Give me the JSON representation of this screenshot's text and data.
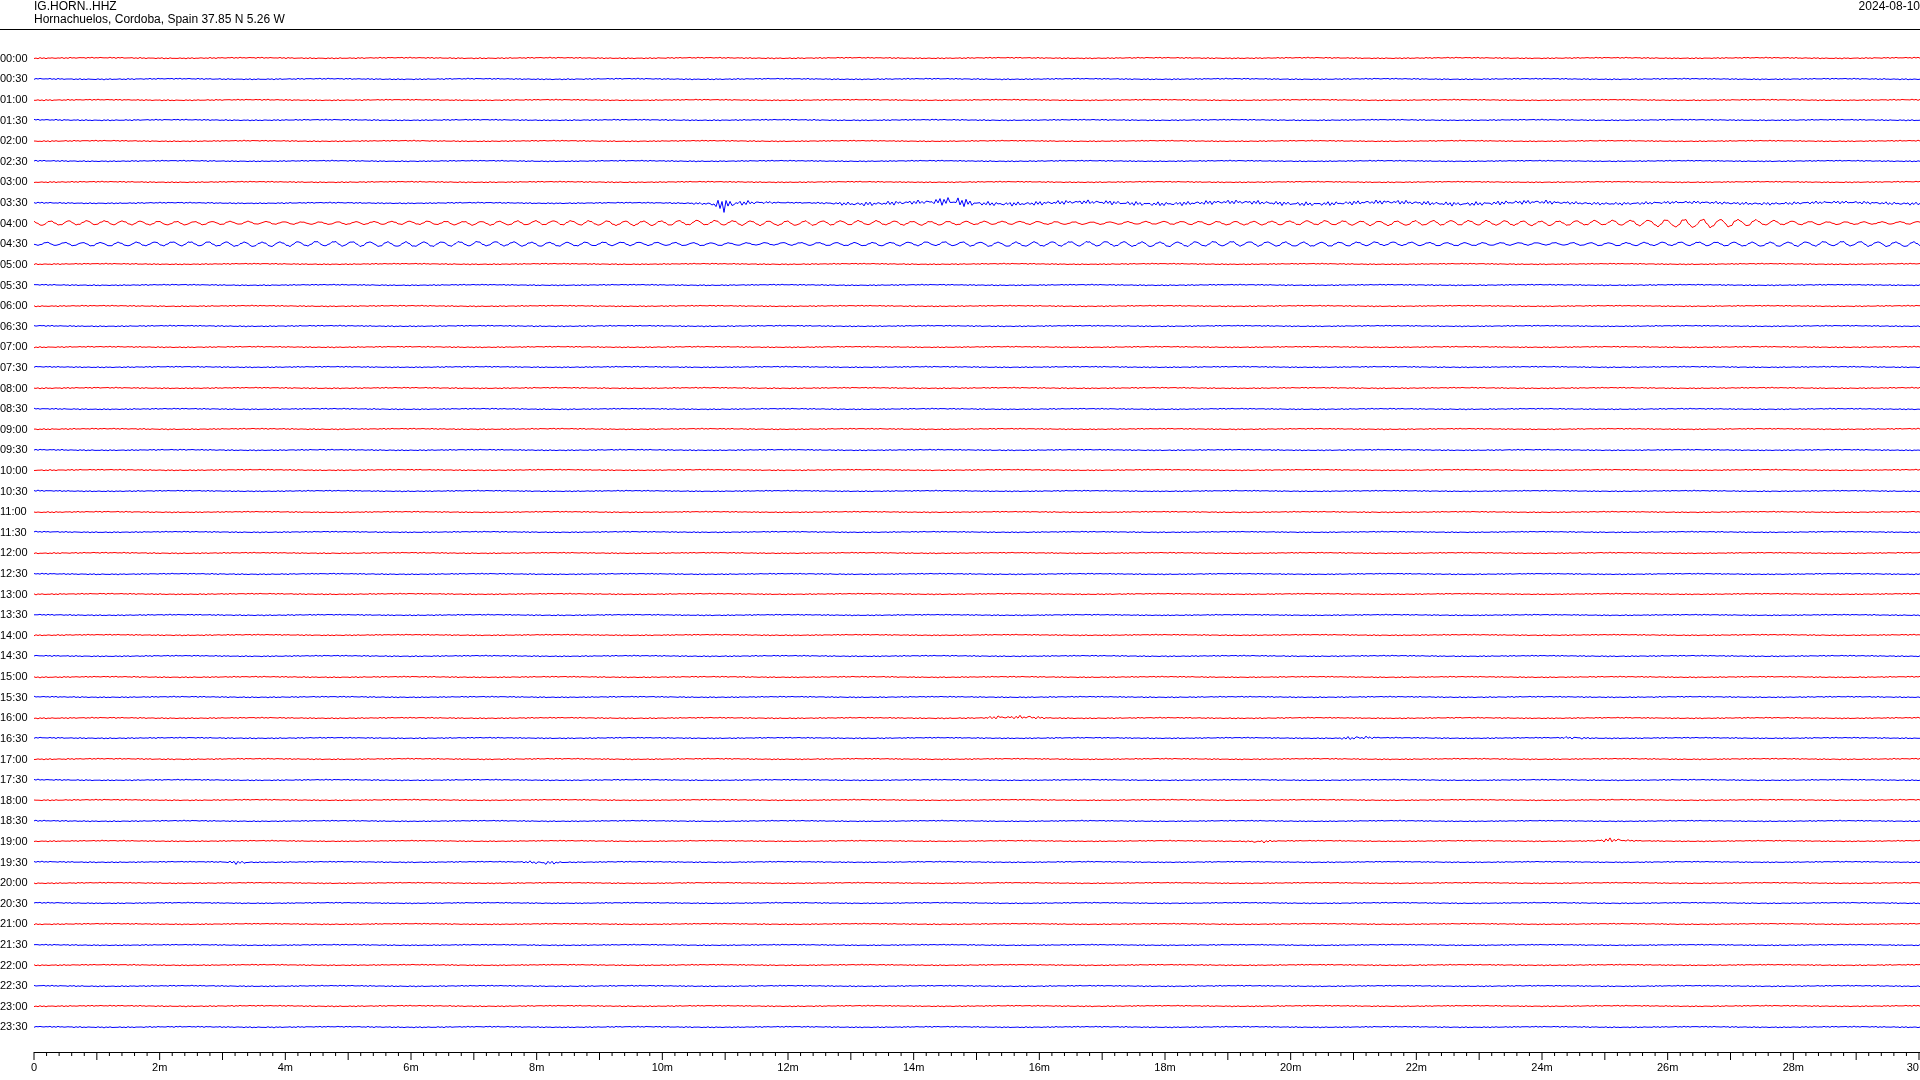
{
  "header": {
    "station": "IG.HORN..HHZ",
    "location": "Hornachuelos, Cordoba, Spain  37.85 N 5.26 W",
    "date": "2024-08-10"
  },
  "traces": [
    {
      "time": "00:00",
      "color": "#ff0000",
      "kind": "quiet"
    },
    {
      "time": "00:30",
      "color": "#0000ff",
      "kind": "quiet"
    },
    {
      "time": "01:00",
      "color": "#ff0000",
      "kind": "quiet"
    },
    {
      "time": "01:30",
      "color": "#0000ff",
      "kind": "quiet"
    },
    {
      "time": "02:00",
      "color": "#ff0000",
      "kind": "quiet"
    },
    {
      "time": "02:30",
      "color": "#0000ff",
      "kind": "quiet"
    },
    {
      "time": "03:00",
      "color": "#ff0000",
      "kind": "quiet"
    },
    {
      "time": "03:30",
      "color": "#0000ff",
      "kind": "event"
    },
    {
      "time": "04:00",
      "color": "#ff0000",
      "kind": "swell"
    },
    {
      "time": "04:30",
      "color": "#0000ff",
      "kind": "swell"
    },
    {
      "time": "05:00",
      "color": "#ff0000",
      "kind": "quiet"
    },
    {
      "time": "05:30",
      "color": "#0000ff",
      "kind": "quiet"
    },
    {
      "time": "06:00",
      "color": "#ff0000",
      "kind": "quiet"
    },
    {
      "time": "06:30",
      "color": "#0000ff",
      "kind": "quiet"
    },
    {
      "time": "07:00",
      "color": "#ff0000",
      "kind": "quiet"
    },
    {
      "time": "07:30",
      "color": "#0000ff",
      "kind": "quiet"
    },
    {
      "time": "08:00",
      "color": "#ff0000",
      "kind": "quiet"
    },
    {
      "time": "08:30",
      "color": "#0000ff",
      "kind": "quiet"
    },
    {
      "time": "09:00",
      "color": "#ff0000",
      "kind": "quiet"
    },
    {
      "time": "09:30",
      "color": "#0000ff",
      "kind": "quiet"
    },
    {
      "time": "10:00",
      "color": "#ff0000",
      "kind": "quiet"
    },
    {
      "time": "10:30",
      "color": "#0000ff",
      "kind": "quiet"
    },
    {
      "time": "11:00",
      "color": "#ff0000",
      "kind": "quiet"
    },
    {
      "time": "11:30",
      "color": "#0000ff",
      "kind": "quiet"
    },
    {
      "time": "12:00",
      "color": "#ff0000",
      "kind": "quiet"
    },
    {
      "time": "12:30",
      "color": "#0000ff",
      "kind": "quiet"
    },
    {
      "time": "13:00",
      "color": "#ff0000",
      "kind": "quiet"
    },
    {
      "time": "13:30",
      "color": "#0000ff",
      "kind": "quiet"
    },
    {
      "time": "14:00",
      "color": "#ff0000",
      "kind": "quiet"
    },
    {
      "time": "14:30",
      "color": "#0000ff",
      "kind": "quiet"
    },
    {
      "time": "15:00",
      "color": "#ff0000",
      "kind": "quiet"
    },
    {
      "time": "15:30",
      "color": "#0000ff",
      "kind": "quiet"
    },
    {
      "time": "16:00",
      "color": "#ff0000",
      "kind": "burst"
    },
    {
      "time": "16:30",
      "color": "#0000ff",
      "kind": "burst"
    },
    {
      "time": "17:00",
      "color": "#ff0000",
      "kind": "quiet"
    },
    {
      "time": "17:30",
      "color": "#0000ff",
      "kind": "quiet"
    },
    {
      "time": "18:00",
      "color": "#ff0000",
      "kind": "quiet"
    },
    {
      "time": "18:30",
      "color": "#0000ff",
      "kind": "quiet"
    },
    {
      "time": "19:00",
      "color": "#ff0000",
      "kind": "burst"
    },
    {
      "time": "19:30",
      "color": "#0000ff",
      "kind": "burst"
    },
    {
      "time": "20:00",
      "color": "#ff0000",
      "kind": "quiet"
    },
    {
      "time": "20:30",
      "color": "#0000ff",
      "kind": "quiet"
    },
    {
      "time": "21:00",
      "color": "#ff0000",
      "kind": "quiet"
    },
    {
      "time": "21:30",
      "color": "#0000ff",
      "kind": "quiet"
    },
    {
      "time": "22:00",
      "color": "#ff0000",
      "kind": "quiet"
    },
    {
      "time": "22:30",
      "color": "#0000ff",
      "kind": "quiet"
    },
    {
      "time": "23:00",
      "color": "#ff0000",
      "kind": "quiet"
    },
    {
      "time": "23:30",
      "color": "#0000ff",
      "kind": "quiet"
    }
  ],
  "time_axis": {
    "ticks": [
      "0",
      "2m",
      "4m",
      "6m",
      "8m",
      "10m",
      "12m",
      "14m",
      "16m",
      "18m",
      "20m",
      "22m",
      "24m",
      "26m",
      "28m",
      "30"
    ]
  }
}
